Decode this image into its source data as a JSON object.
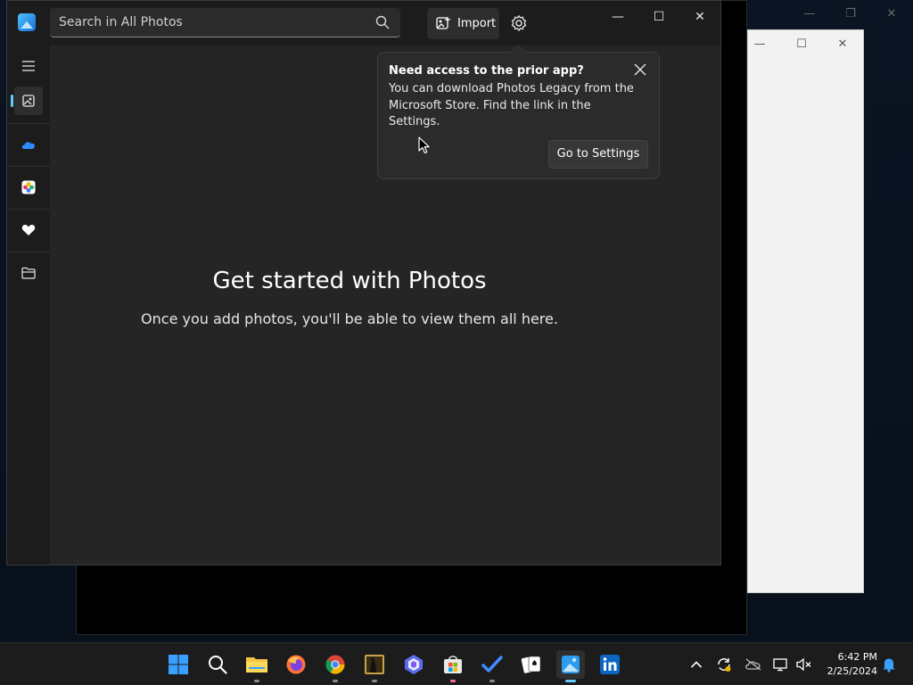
{
  "photos_window": {
    "search": {
      "placeholder": "Search in All Photos"
    },
    "toolbar": {
      "import_label": "Import"
    },
    "window_controls": {
      "minimize": "—",
      "maximize": "☐",
      "close": "✕"
    }
  },
  "sidebar": {
    "items": [
      {
        "name": "menu",
        "icon": "hamburger-icon"
      },
      {
        "name": "all-photos",
        "icon": "photos-icon",
        "active": true
      },
      {
        "name": "onedrive",
        "icon": "onedrive-cloud-icon"
      },
      {
        "name": "icloud",
        "icon": "icloud-photos-icon"
      },
      {
        "name": "favorites",
        "icon": "heart-icon"
      },
      {
        "name": "folders",
        "icon": "folder-icon"
      }
    ]
  },
  "main": {
    "headline": "Get started with Photos",
    "subtext": "Once you add photos, you'll be able to view them all here."
  },
  "teaching_tip": {
    "title": "Need access to the prior app?",
    "body": "You can download Photos Legacy from the Microsoft Store. Find the link in the Settings.",
    "button": "Go to Settings"
  },
  "taskbar": {
    "apps": [
      "start",
      "search",
      "file-explorer",
      "firefox",
      "chrome",
      "image-viewer",
      "copilot",
      "microsoft-store",
      "todo",
      "solitaire",
      "photos",
      "linkedin"
    ],
    "clock": {
      "time": "6:42 PM",
      "date": "2/25/2024"
    }
  },
  "colors": {
    "accent": "#60cdff",
    "window_bg": "#202020",
    "tip_bg": "#2b2b2b"
  }
}
